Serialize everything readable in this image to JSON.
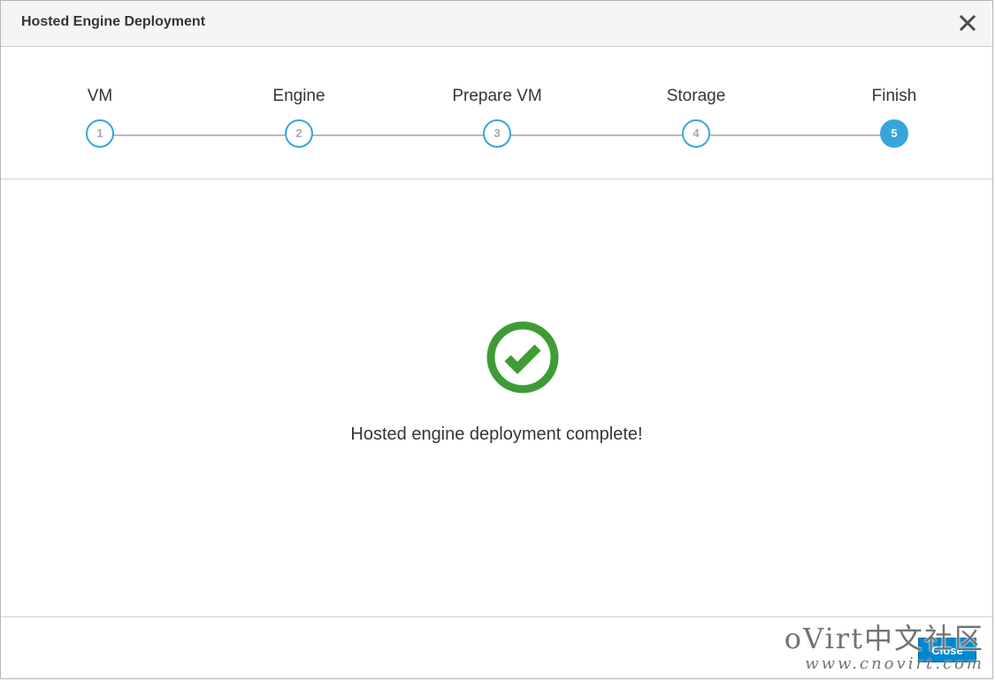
{
  "dialog": {
    "title": "Hosted Engine Deployment",
    "close_icon": "close-icon"
  },
  "wizard": {
    "steps": [
      {
        "label": "VM",
        "number": "1",
        "state": "completed"
      },
      {
        "label": "Engine",
        "number": "2",
        "state": "completed"
      },
      {
        "label": "Prepare VM",
        "number": "3",
        "state": "completed"
      },
      {
        "label": "Storage",
        "number": "4",
        "state": "completed"
      },
      {
        "label": "Finish",
        "number": "5",
        "state": "active"
      }
    ]
  },
  "result": {
    "icon": "check-circle-icon",
    "message": "Hosted engine deployment complete!",
    "icon_color": "#3f9c35"
  },
  "footer": {
    "close_label": "Close"
  },
  "watermark": {
    "line1": "oVirt中文社区",
    "line2": "www.cnovirt.com"
  },
  "colors": {
    "accent": "#39a5dc",
    "success": "#3f9c35",
    "button": "#0088ce"
  }
}
